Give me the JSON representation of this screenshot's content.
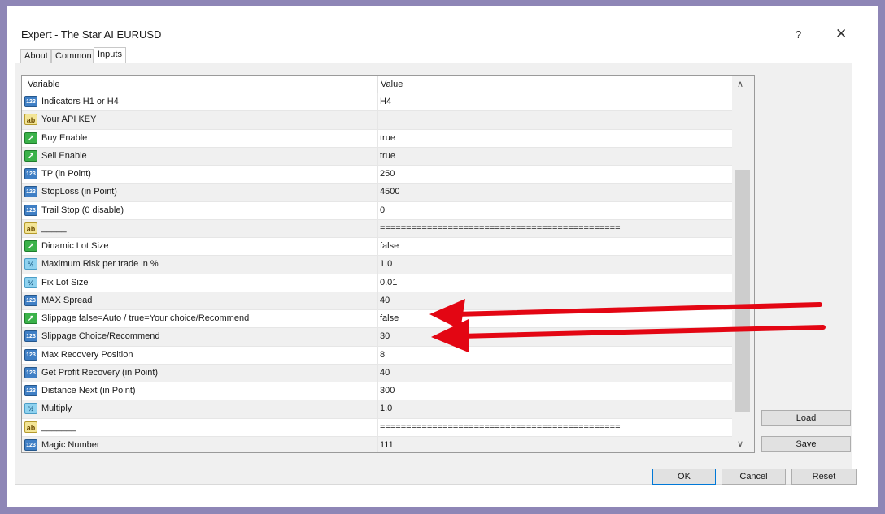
{
  "window": {
    "title": "Expert - The Star AI EURUSD",
    "help": "?",
    "close": "✕"
  },
  "tabs": [
    "About",
    "Common",
    "Inputs"
  ],
  "table": {
    "headers": {
      "variable": "Variable",
      "value": "Value"
    },
    "rows": [
      {
        "type": "int",
        "name": "Indicators H1 or H4",
        "value": "H4"
      },
      {
        "type": "string",
        "name": "Your API KEY",
        "value": ""
      },
      {
        "type": "bool",
        "name": "Buy Enable",
        "value": "true"
      },
      {
        "type": "bool",
        "name": "Sell Enable",
        "value": "true"
      },
      {
        "type": "int",
        "name": "TP (in Point)",
        "value": "250"
      },
      {
        "type": "int",
        "name": "StopLoss (in Point)",
        "value": "4500"
      },
      {
        "type": "int",
        "name": "Trail Stop (0 disable)",
        "value": "0"
      },
      {
        "type": "string",
        "name": "_____",
        "value": "=============================================="
      },
      {
        "type": "bool",
        "name": "Dinamic Lot Size",
        "value": "false"
      },
      {
        "type": "double",
        "name": "Maximum Risk per trade in %",
        "value": "1.0"
      },
      {
        "type": "double",
        "name": "Fix Lot Size",
        "value": "0.01"
      },
      {
        "type": "int",
        "name": "MAX Spread",
        "value": "40"
      },
      {
        "type": "bool",
        "name": "Slippage false=Auto / true=Your choice/Recommend",
        "value": "false"
      },
      {
        "type": "int",
        "name": "Slippage Choice/Recommend",
        "value": "30"
      },
      {
        "type": "int",
        "name": "Max Recovery Position",
        "value": "8"
      },
      {
        "type": "int",
        "name": "Get Profit Recovery (in Point)",
        "value": "40"
      },
      {
        "type": "int",
        "name": "Distance Next (in Point)",
        "value": "300"
      },
      {
        "type": "double",
        "name": "Multiply",
        "value": "1.0"
      },
      {
        "type": "string",
        "name": "_______",
        "value": "=============================================="
      },
      {
        "type": "int",
        "name": "Magic Number",
        "value": "111"
      }
    ]
  },
  "icons": {
    "int": "123",
    "string": "ab",
    "bool": "↗",
    "double": "½"
  },
  "buttons": {
    "load": "Load",
    "save": "Save",
    "ok": "OK",
    "cancel": "Cancel",
    "reset": "Reset"
  },
  "scroll": {
    "up": "∧",
    "down": "∨"
  },
  "colors": {
    "arrow": "#e30613",
    "background": "#8e86b6",
    "accent": "#0078d7"
  }
}
